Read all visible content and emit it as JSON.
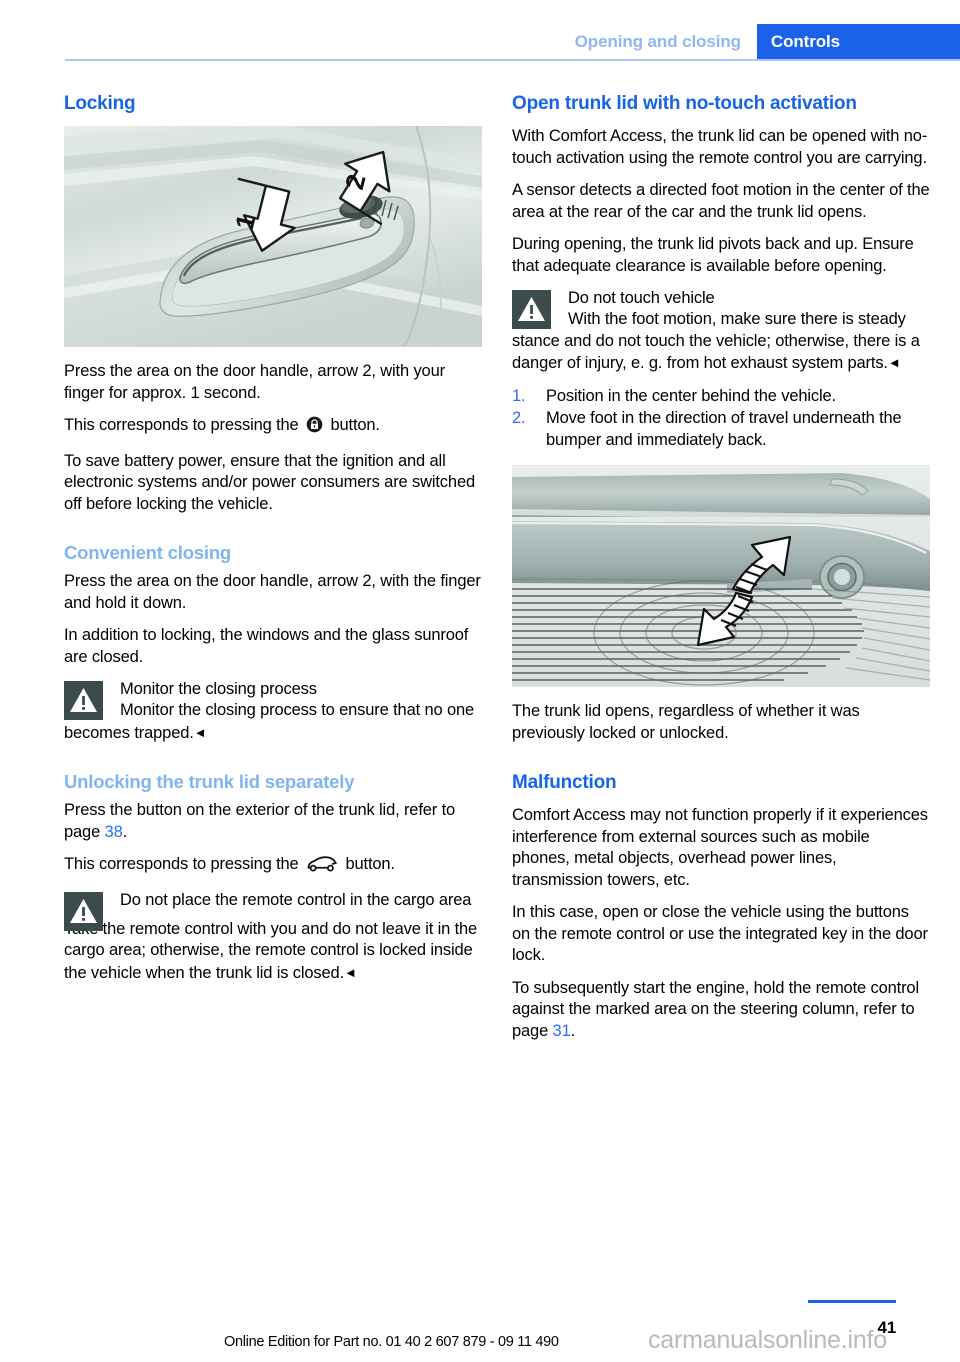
{
  "header": {
    "section": "Opening and closing",
    "chapter": "Controls"
  },
  "left_column": {
    "locking_heading": "Locking",
    "figure_door_handle": "door-handle-illustration",
    "p1": "Press the area on the door handle, arrow 2, with your finger for approx. 1 second.",
    "p2_before": "This corresponds to pressing the",
    "p2_after": "button.",
    "p3": "To save battery power, ensure that the ignition and all electronic systems and/or power consumers are switched off before locking the vehicle.",
    "convenient_closing_heading": "Convenient closing",
    "p4": "Press the area on the door handle, arrow 2, with the finger and hold it down.",
    "p5": "In addition to locking, the windows and the glass sunroof are closed.",
    "warn1_title": "Monitor the closing process",
    "warn1_body": "Monitor the closing process to ensure that no one becomes trapped.",
    "warn1_end": "◄",
    "unlocking_trunk_heading": "Unlocking the trunk lid separately",
    "p6_before": "Press the button on the exterior of the trunk lid, refer to page",
    "p6_pageref": "38",
    "p6_after": ".",
    "p7_before": "This corresponds to pressing the",
    "p7_after": "button.",
    "warn2_title": "Do not place the remote control in the cargo area",
    "warn2_body": "Take the remote control with you and do not leave it in the cargo area; otherwise, the remote control is locked inside the vehicle when the trunk lid is closed.",
    "warn2_end": "◄"
  },
  "right_column": {
    "open_trunk_heading": "Open trunk lid with no-touch activation",
    "r1": "With Comfort Access, the trunk lid can be opened with no-touch activation using the remote control you are carrying.",
    "r2": "A sensor detects a directed foot motion in the center of the area at the rear of the car and the trunk lid opens.",
    "r3": "During opening, the trunk lid pivots back and up. Ensure that adequate clearance is available before opening.",
    "warn3_title": "Do not touch vehicle",
    "warn3_body": "With the foot motion, make sure there is steady stance and do not touch the vehicle; otherwise, there is a danger of injury, e. g. from hot exhaust system parts.",
    "warn3_end": "◄",
    "steps": [
      {
        "num": "1.",
        "text": "Position in the center behind the vehicle."
      },
      {
        "num": "2.",
        "text": "Move foot in the direction of travel underneath the bumper and immediately back."
      }
    ],
    "figure_bumper": "rear-bumper-foot-motion-illustration",
    "r4": "The trunk lid opens, regardless of whether it was previously locked or unlocked.",
    "malfunction_heading": "Malfunction",
    "r5": "Comfort Access may not function properly if it experiences interference from external sources such as mobile phones, metal objects, overhead power lines, transmission towers, etc.",
    "r6": "In this case, open or close the vehicle using the buttons on the remote control or use the integrated key in the door lock.",
    "r7_before": "To subsequently start the engine, hold the remote control against the marked area on the steering column, refer to page",
    "r7_pageref": "31",
    "r7_after": "."
  },
  "footer": {
    "page_number": "41",
    "note": "Online Edition for Part no. 01 40 2 607 879 - 09 11 490",
    "watermark": "carmanualsonline.info"
  },
  "colors": {
    "chapter_tab_bg": "#1a62ea",
    "section_tab_text": "#8fb8f0",
    "main_heading": "#1764e8",
    "sub_heading": "#82b4f0",
    "page_link": "#2a6ff0",
    "warning_icon_bg": "#3c4b4b"
  },
  "figures": {
    "door_handle_labels": [
      "1",
      "2"
    ]
  }
}
